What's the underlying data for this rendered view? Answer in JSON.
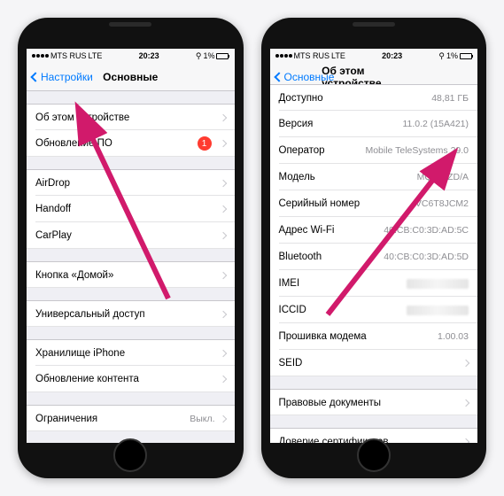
{
  "status": {
    "carrier": "MTS RUS",
    "network": "LTE",
    "time": "20:23",
    "battery": "1%"
  },
  "phone1": {
    "back": "Настройки",
    "title": "Основные",
    "sections": [
      [
        {
          "label": "Об этом устройстве",
          "chevron": true
        },
        {
          "label": "Обновление ПО",
          "badge": "1",
          "chevron": true
        }
      ],
      [
        {
          "label": "AirDrop",
          "chevron": true
        },
        {
          "label": "Handoff",
          "chevron": true
        },
        {
          "label": "CarPlay",
          "chevron": true
        }
      ],
      [
        {
          "label": "Кнопка «Домой»",
          "chevron": true
        }
      ],
      [
        {
          "label": "Универсальный доступ",
          "chevron": true
        }
      ],
      [
        {
          "label": "Хранилище iPhone",
          "chevron": true
        },
        {
          "label": "Обновление контента",
          "chevron": true
        }
      ],
      [
        {
          "label": "Ограничения",
          "value": "Выкл.",
          "chevron": true
        }
      ]
    ]
  },
  "phone2": {
    "back": "Основные",
    "title": "Об этом устройстве",
    "sections": [
      [
        {
          "label": "Доступно",
          "value": "48,81 ГБ"
        },
        {
          "label": "Версия",
          "value": "11.0.2 (15A421)"
        },
        {
          "label": "Оператор",
          "value": "Mobile TeleSystems 29.0"
        },
        {
          "label": "Модель",
          "value": "MQ8L2ZD/A"
        },
        {
          "label": "Серийный номер",
          "value": "VC6T8JCM2"
        },
        {
          "label": "Адрес Wi-Fi",
          "value": "40:CB:C0:3D:AD:5C"
        },
        {
          "label": "Bluetooth",
          "value": "40:CB:C0:3D:AD:5D"
        },
        {
          "label": "IMEI",
          "blur": true
        },
        {
          "label": "ICCID",
          "blur": true
        },
        {
          "label": "Прошивка модема",
          "value": "1.00.03"
        },
        {
          "label": "SEID",
          "chevron": true
        }
      ],
      [
        {
          "label": "Правовые документы",
          "chevron": true
        }
      ],
      [
        {
          "label": "Доверие сертификатов",
          "chevron": true
        }
      ]
    ]
  }
}
